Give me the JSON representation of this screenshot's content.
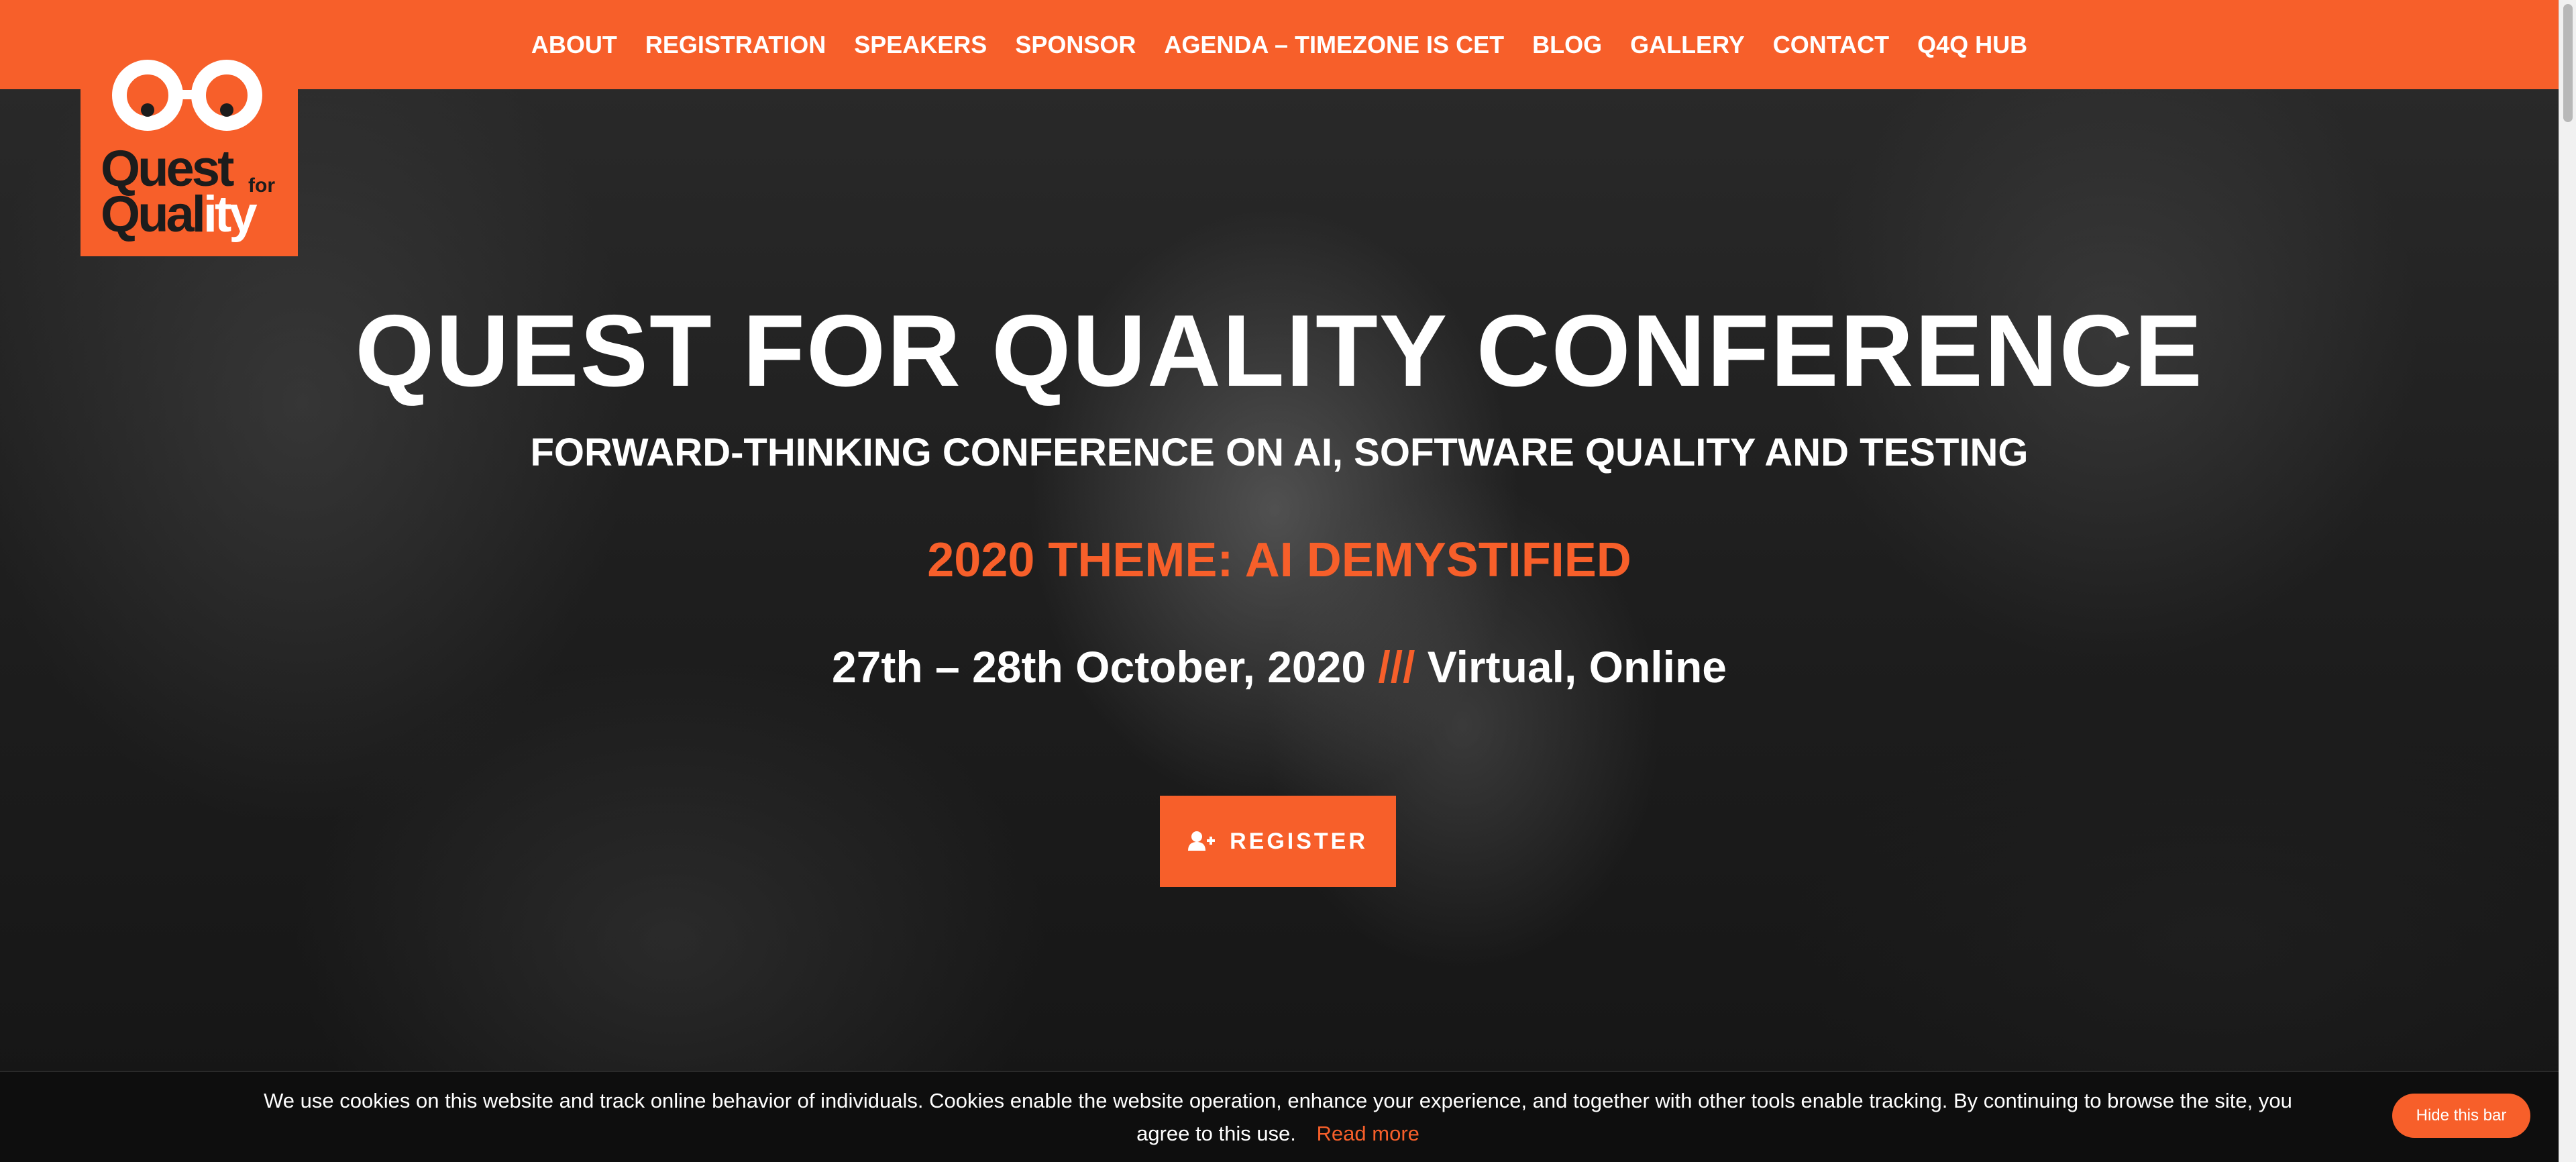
{
  "nav": {
    "items": [
      {
        "label": "ABOUT"
      },
      {
        "label": "REGISTRATION"
      },
      {
        "label": "SPEAKERS"
      },
      {
        "label": "SPONSOR"
      },
      {
        "label": "AGENDA – TIMEZONE IS CET"
      },
      {
        "label": "BLOG"
      },
      {
        "label": "GALLERY"
      },
      {
        "label": "CONTACT"
      },
      {
        "label": "Q4Q HUB"
      }
    ]
  },
  "logo": {
    "line1": "Quest",
    "line2_a": "Qual",
    "line2_b": "ity",
    "for": "for",
    "icon": "glasses-icon"
  },
  "hero": {
    "title": "QUEST FOR QUALITY CONFERENCE",
    "subtitle": "FORWARD-THINKING CONFERENCE ON AI, SOFTWARE QUALITY AND TESTING",
    "theme": "2020 THEME: AI DEMYSTIFIED",
    "date": "27th – 28th October, 2020",
    "separator": "///",
    "location": "Virtual, Online",
    "register_label": "REGISTER",
    "register_icon": "add-user-icon"
  },
  "cookie": {
    "text": "We use cookies on this website and track online behavior of individuals. Cookies enable the website operation, enhance your experience, and together with other tools enable tracking. By continuing to browse the site, you agree to this use.",
    "read_more": "Read more",
    "hide_label": "Hide this bar"
  },
  "colors": {
    "accent": "#f75f2a",
    "text": "#ffffff",
    "cookie_bg": "#0e0e0e"
  }
}
